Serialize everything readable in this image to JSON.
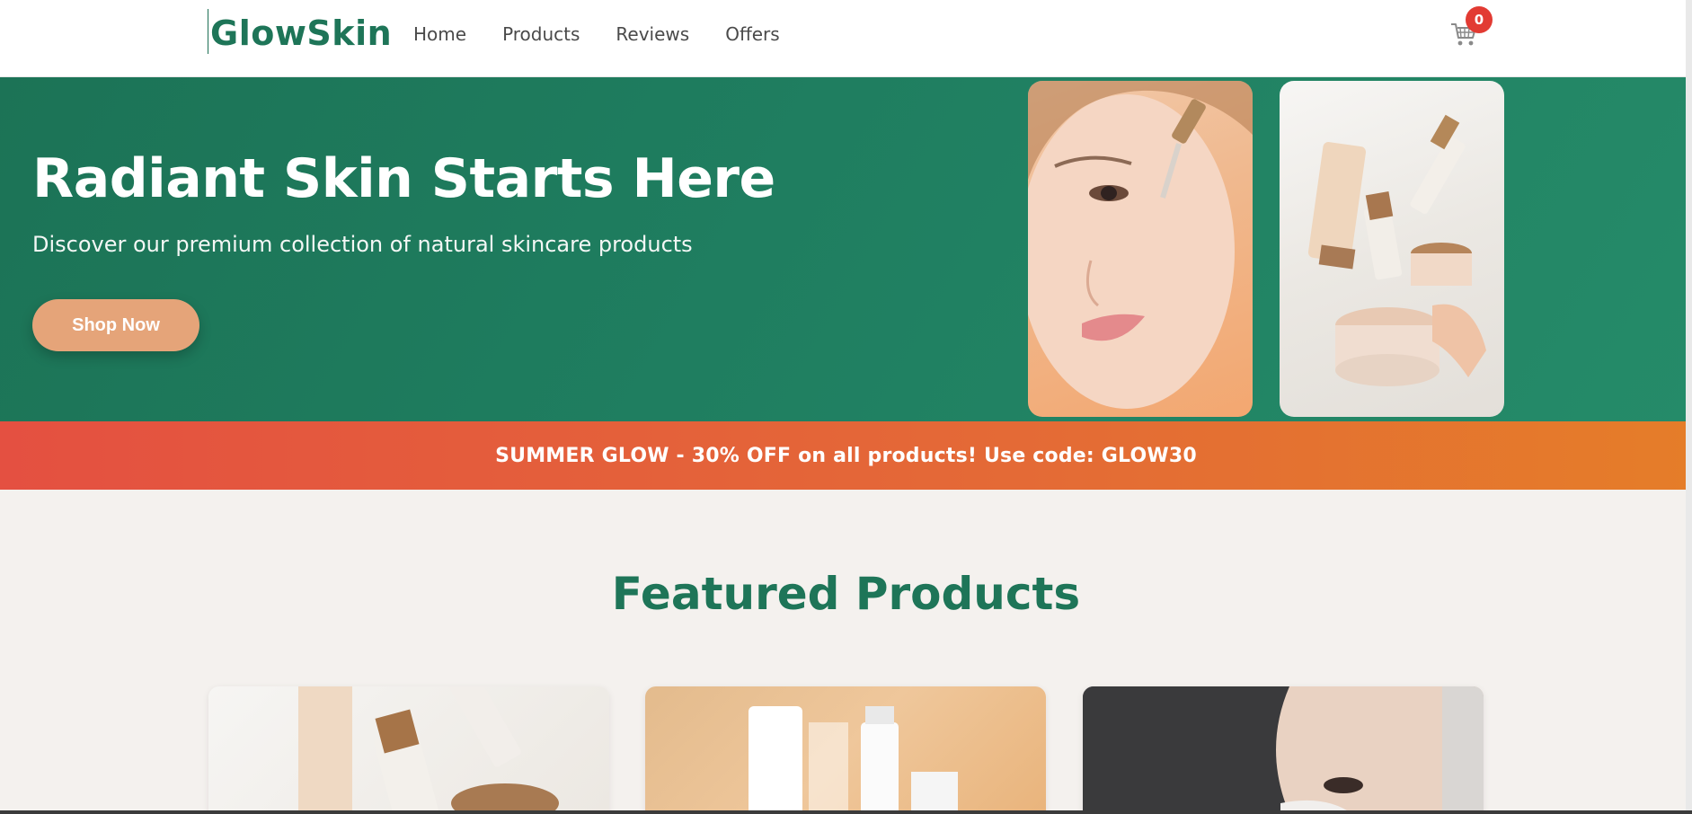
{
  "brand": {
    "name": "GlowSkin"
  },
  "nav": {
    "items": [
      "Home",
      "Products",
      "Reviews",
      "Offers"
    ]
  },
  "cart": {
    "count": "0",
    "icon": "cart-icon"
  },
  "hero": {
    "title": "Radiant Skin Starts Here",
    "subtitle": "Discover our premium collection of natural skincare products",
    "cta": "Shop Now"
  },
  "promo": {
    "text": "SUMMER GLOW - 30% OFF on all products! Use code: GLOW30"
  },
  "featured": {
    "title": "Featured Products"
  },
  "colors": {
    "brand_green": "#1e7558",
    "accent_peach": "#e5a479",
    "badge_red": "#e23b33",
    "promo_start": "#e45041",
    "promo_end": "#e57d29"
  }
}
